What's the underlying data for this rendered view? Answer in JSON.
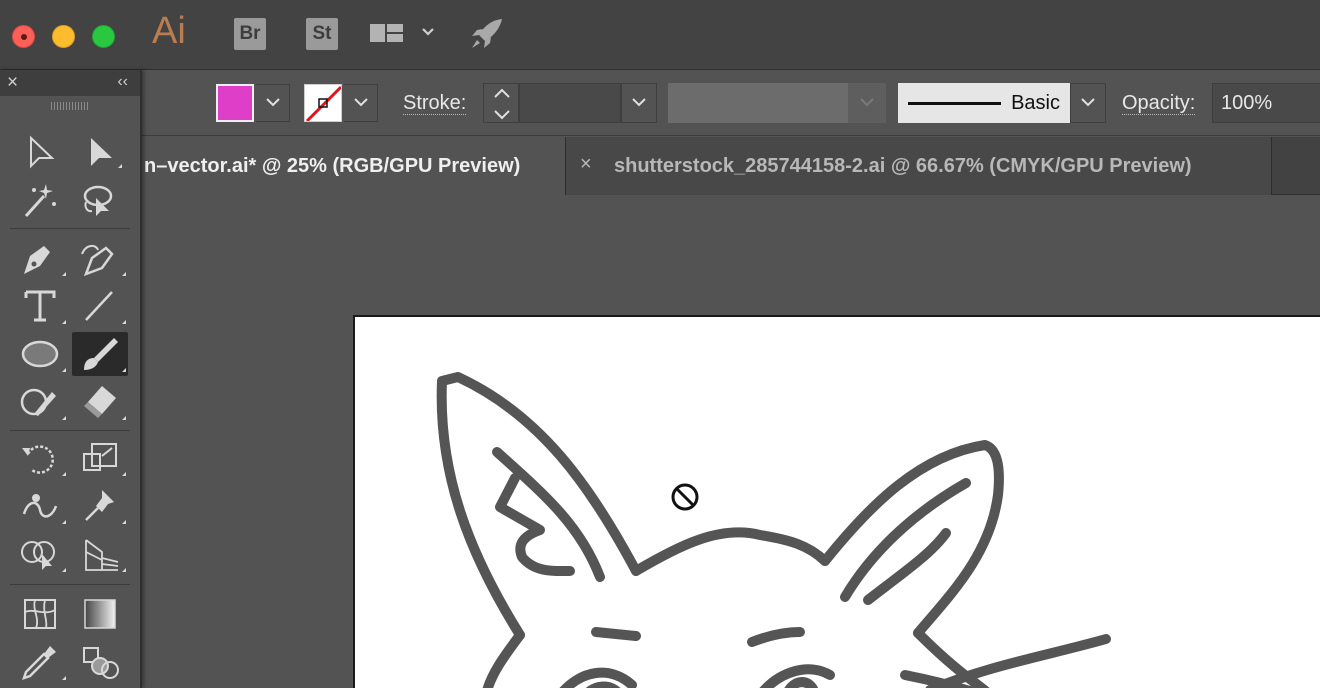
{
  "window": {
    "app_logo": "Ai",
    "bridge_label": "Br",
    "stock_label": "St"
  },
  "control_bar": {
    "fill_color": "#de3ec8",
    "stroke_label": "Stroke:",
    "stroke_weight_value": "",
    "brush_definition": "Basic",
    "opacity_label": "Opacity:",
    "opacity_value": "100%"
  },
  "tabs": [
    {
      "label": "n–vector.ai* @ 25% (RGB/GPU Preview)",
      "active": true
    },
    {
      "label": "shutterstock_285744158-2.ai @ 66.67% (CMYK/GPU Preview)",
      "active": false,
      "close_glyph": "×"
    }
  ],
  "tools_panel": {
    "close_glyph": "×",
    "collapse_glyph": "‹‹",
    "active_tool": "paintbrush-tool"
  },
  "colors": {
    "chrome_dark": "#434343",
    "panel": "#535353",
    "stroke_art": "#555555",
    "brand_ai": "#b97d52"
  }
}
